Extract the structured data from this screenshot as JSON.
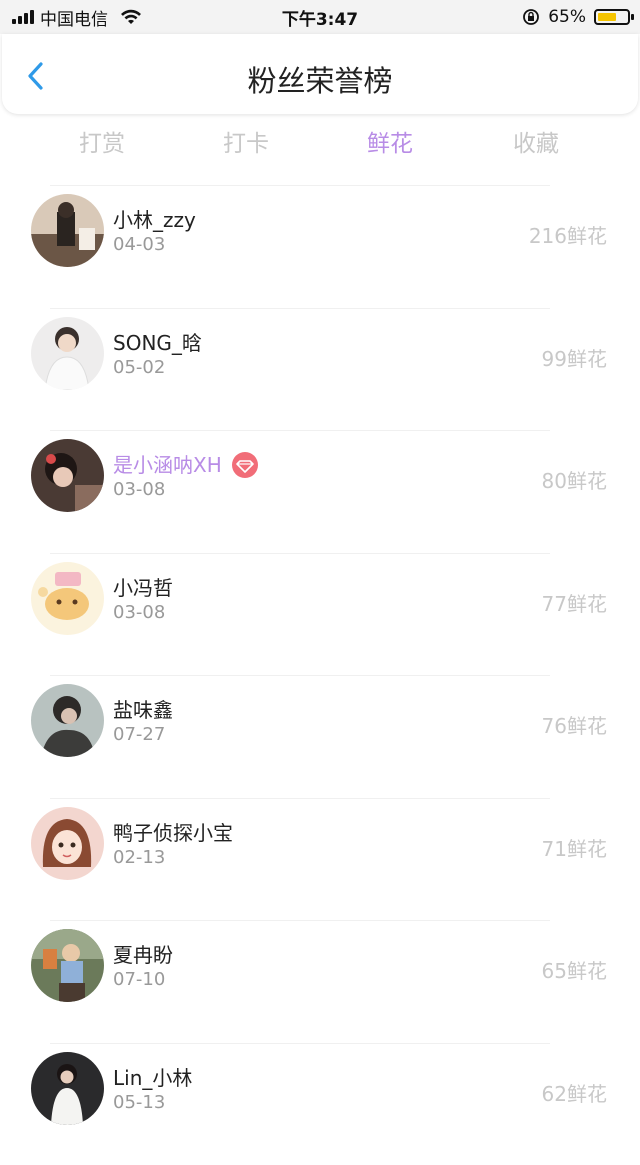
{
  "status_bar": {
    "carrier": "中国电信",
    "time": "下午3:47",
    "battery": "65%",
    "battery_level": 0.65
  },
  "header": {
    "title": "粉丝荣誉榜"
  },
  "tabs": [
    {
      "label": "打赏",
      "active": false
    },
    {
      "label": "打卡",
      "active": false
    },
    {
      "label": "鲜花",
      "active": true
    },
    {
      "label": "收藏",
      "active": false
    }
  ],
  "fans": [
    {
      "name": "小林_zzy",
      "date": "04-03",
      "count": "216鲜花",
      "vip": false
    },
    {
      "name": "SONG_晗",
      "date": "05-02",
      "count": "99鲜花",
      "vip": false
    },
    {
      "name": "是小涵呐XH",
      "date": "03-08",
      "count": "80鲜花",
      "vip": true
    },
    {
      "name": "小冯哲",
      "date": "03-08",
      "count": "77鲜花",
      "vip": false
    },
    {
      "name": "盐味鑫",
      "date": "07-27",
      "count": "76鲜花",
      "vip": false
    },
    {
      "name": "鸭子侦探小宝",
      "date": "02-13",
      "count": "71鲜花",
      "vip": false
    },
    {
      "name": "夏冉盼",
      "date": "07-10",
      "count": "65鲜花",
      "vip": false
    },
    {
      "name": "Lin_小林",
      "date": "05-13",
      "count": "62鲜花",
      "vip": false
    }
  ],
  "colors": {
    "accent": "#b88ce6",
    "tab_inactive": "#c8c8c8",
    "back": "#2f9ae8",
    "badge": "#f16d78"
  }
}
